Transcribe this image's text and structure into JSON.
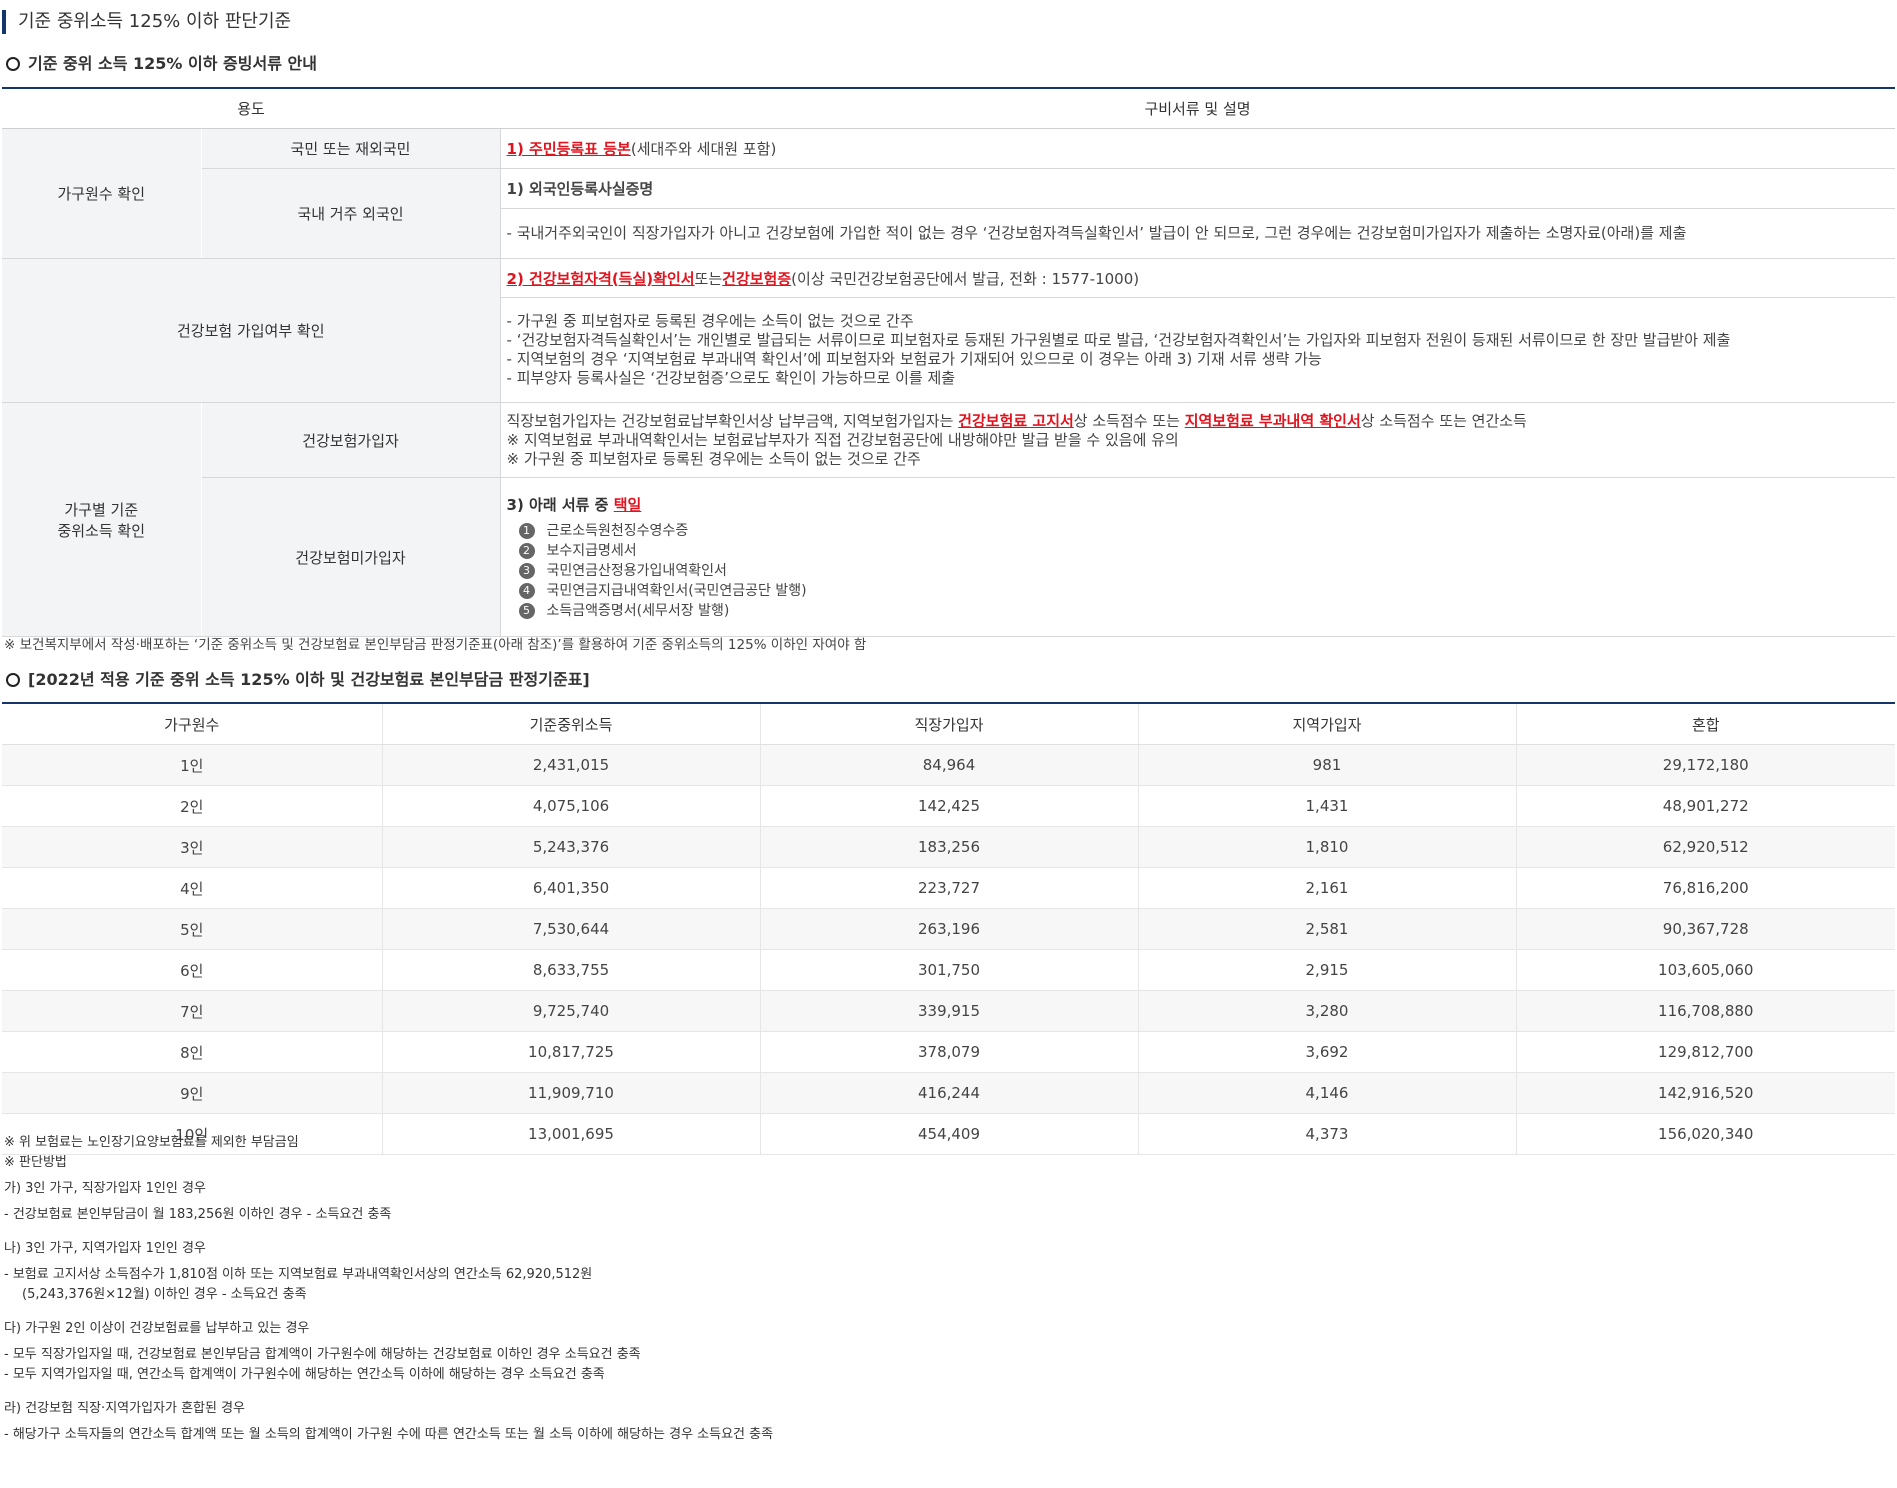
{
  "page_title": "기준 중위소득 125% 이하 판단기준",
  "section1_title": "기준 중위 소득 125% 이하 증빙서류 안내",
  "doc_table": {
    "col_use": "용도",
    "col_docs": "구비서류 및 설명",
    "group1_label": "가구원수 확인",
    "row1_label": "국민 또는 재외국민",
    "row1_doc_link": "1) 주민등록표 등본",
    "row1_doc_rest": "(세대주와 세대원 포함)",
    "row2_label": "국내 거주 외국인",
    "row2_title": "1) 외국인등록사실증명",
    "row2_note": "- 국내거주외국인이 직장가입자가 아니고 건강보험에 가입한 적이 없는 경우 ‘건강보험자격득실확인서’ 발급이 안 되므로, 그런 경우에는 건강보험미가입자가 제출하는 소명자료(아래)를 제출",
    "group2_label": "건강보험 가입여부 확인",
    "row3_link1": "2) 건강보험자격(득실)확인서",
    "row3_mid": "또는",
    "row3_link2": "건강보험증",
    "row3_rest": "(이상 국민건강보험공단에서 발급, 전화 : 1577-1000)",
    "row3_notes": [
      "- 가구원 중 피보험자로 등록된 경우에는 소득이 없는 것으로 간주",
      "- ‘건강보험자격득실확인서’는 개인별로 발급되는 서류이므로 피보험자로 등재된 가구원별로 따로 발급, ‘건강보험자격확인서’는 가입자와 피보험자 전원이 등재된 서류이므로 한 장만 발급받아 제출",
      "- 지역보험의 경우 ‘지역보험료 부과내역 확인서’에 피보험자와 보험료가 기재되어 있으므로 이 경우는 아래 3) 기재 서류 생략 가능",
      "- 피부양자 등록사실은 ‘건강보험증’으로도 확인이 가능하므로 이를 제출"
    ],
    "group3_label_line1": "가구별 기준",
    "group3_label_line2": "중위소득 확인",
    "row4_label": "건강보험가입자",
    "row4_text1": "직장보험가입자는 건강보험료납부확인서상 납부금액, 지역보험가입자는 ",
    "row4_link1": "건강보험료 고지서",
    "row4_text2": "상 소득점수 또는 ",
    "row4_link2": "지역보험료 부과내역 확인서",
    "row4_text3": "상 소득점수 또는 연간소득",
    "row4_line2": "※ 지역보험료 부과내역확인서는 보험료납부자가 직접 건강보험공단에 내방해야만 발급 받을 수 있음에 유의",
    "row4_line3": "※ 가구원 중 피보험자로 등록된 경우에는 소득이 없는 것으로 간주",
    "row5_label": "건강보험미가입자",
    "row5_title": "3) 아래 서류 중 ",
    "row5_title_pick": "택일",
    "row5_items": [
      {
        "n": "1",
        "text": "근로소득원천징수영수증"
      },
      {
        "n": "2",
        "text": "보수지급명세서"
      },
      {
        "n": "3",
        "text": "국민연금산정용가입내역확인서"
      },
      {
        "n": "4",
        "text": "국민연금지급내역확인서(국민연금공단 발행)"
      },
      {
        "n": "5",
        "text": "소득금액증명서(세무서장 발행)"
      }
    ]
  },
  "note_after_doc": "※ 보건복지부에서 작성·배포하는 ‘기준 중위소득 및 건강보험료 본인부담금 판정기준표(아래 참조)’를 활용하여 기준 중위소득의 125% 이하인 자여야 함",
  "section2_title": "[2022년 적용 기준 중위 소득 125% 이하 및 건강보험료 본인부담금 판정기준표]",
  "income_table": {
    "headers": [
      "가구원수",
      "기준중위소득",
      "직장가입자",
      "지역가입자",
      "혼합"
    ],
    "rows": [
      [
        "1인",
        "2,431,015",
        "84,964",
        "981",
        "29,172,180"
      ],
      [
        "2인",
        "4,075,106",
        "142,425",
        "1,431",
        "48,901,272"
      ],
      [
        "3인",
        "5,243,376",
        "183,256",
        "1,810",
        "62,920,512"
      ],
      [
        "4인",
        "6,401,350",
        "223,727",
        "2,161",
        "76,816,200"
      ],
      [
        "5인",
        "7,530,644",
        "263,196",
        "2,581",
        "90,367,728"
      ],
      [
        "6인",
        "8,633,755",
        "301,750",
        "2,915",
        "103,605,060"
      ],
      [
        "7인",
        "9,725,740",
        "339,915",
        "3,280",
        "116,708,880"
      ],
      [
        "8인",
        "10,817,725",
        "378,079",
        "3,692",
        "129,812,700"
      ],
      [
        "9인",
        "11,909,710",
        "416,244",
        "4,146",
        "142,916,520"
      ],
      [
        "10인",
        "13,001,695",
        "454,409",
        "4,373",
        "156,020,340"
      ]
    ]
  },
  "footnotes": {
    "n1": "※ 위 보험료는 노인장기요양보험료를 제외한 부담금임",
    "n2": "※ 판단방법",
    "a_title": "가) 3인 가구, 직장가입자 1인인 경우",
    "a_1": "- 건강보험료 본인부담금이 월 183,256원 이하인 경우 - 소득요건 충족",
    "b_title": "나) 3인 가구, 지역가입자 1인인 경우",
    "b_1": "- 보험료 고지서상 소득점수가 1,810점 이하 또는 지역보험료 부과내역확인서상의 연간소득 62,920,512원",
    "b_2": "(5,243,376원×12월) 이하인 경우 - 소득요건 충족",
    "c_title": "다) 가구원 2인 이상이 건강보험료를 납부하고 있는 경우",
    "c_1": "- 모두 직장가입자일 때, 건강보험료 본인부담금 합계액이 가구원수에 해당하는 건강보험료 이하인 경우 소득요건 충족",
    "c_2": "- 모두 지역가입자일 때, 연간소득 합계액이 가구원수에 해당하는 연간소득 이하에 해당하는 경우 소득요건 충족",
    "d_title": "라) 건강보험 직장·지역가입자가 혼합된 경우",
    "d_1": "- 해당가구 소득자들의 연간소득 합계액 또는 월 소득의 합계액이 가구원 수에 따른 연간소득 또는 월 소득 이하에 해당하는 경우 소득요건 충족"
  }
}
